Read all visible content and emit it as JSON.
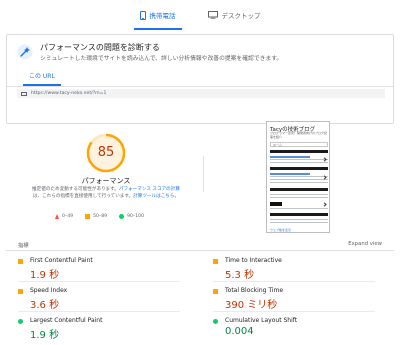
{
  "device_tabs": [
    {
      "label": "携帯電話",
      "icon": "phone-icon",
      "active": true
    },
    {
      "label": "デスクトップ",
      "icon": "desktop-icon",
      "active": false
    }
  ],
  "diagnose": {
    "title": "パフォーマンスの問題を診断する",
    "subtitle": "シミュレートした環境でサイトを読み込んで、詳しい分析情報や改善の提案を確認できます。",
    "url_tab": "この URL",
    "url": "https://www.tacy-neko.net/?m=1"
  },
  "score": {
    "value": "85",
    "fraction": 0.85,
    "label": "パフォーマンス",
    "desc_1": "推定値のため変動する可能性があります。",
    "desc_link_1": "パフォーマンス スコアの計算",
    "desc_2": "は、これらの指標を直接使用して行っています。",
    "desc_link_2": "計算ツールはこちら",
    "desc_3": "。"
  },
  "legend": [
    {
      "shape": "triangle",
      "range": "0–49",
      "color": "#ff4e42"
    },
    {
      "shape": "square",
      "range": "50–89",
      "color": "#ffa400"
    },
    {
      "shape": "circle",
      "range": "90–100",
      "color": "#0cce6b"
    }
  ],
  "screenshot": {
    "title": "Tacyの技術ブログ",
    "subtitle": "プログラマー必見！開発者向けのブログ記事を紹介",
    "nav": "ホーム",
    "footer": "ウェブ版を表示"
  },
  "metrics": {
    "title": "指標",
    "expand": "Expand view",
    "items": [
      {
        "name": "First Contentful Paint",
        "value": "1.9 秒",
        "status": "average"
      },
      {
        "name": "Time to Interactive",
        "value": "5.3 秒",
        "status": "average"
      },
      {
        "name": "Speed Index",
        "value": "3.6 秒",
        "status": "average"
      },
      {
        "name": "Total Blocking Time",
        "value": "390 ミリ秒",
        "status": "average"
      },
      {
        "name": "Largest Contentful Paint",
        "value": "1.9 秒",
        "status": "good"
      },
      {
        "name": "Cumulative Layout Shift",
        "value": "0.004",
        "status": "good"
      }
    ]
  },
  "colors": {
    "accent": "#1a73e8",
    "average": "#ffa400",
    "average_text": "#c33300",
    "good": "#0cce6b",
    "good_text": "#018642",
    "fail": "#ff4e42"
  }
}
